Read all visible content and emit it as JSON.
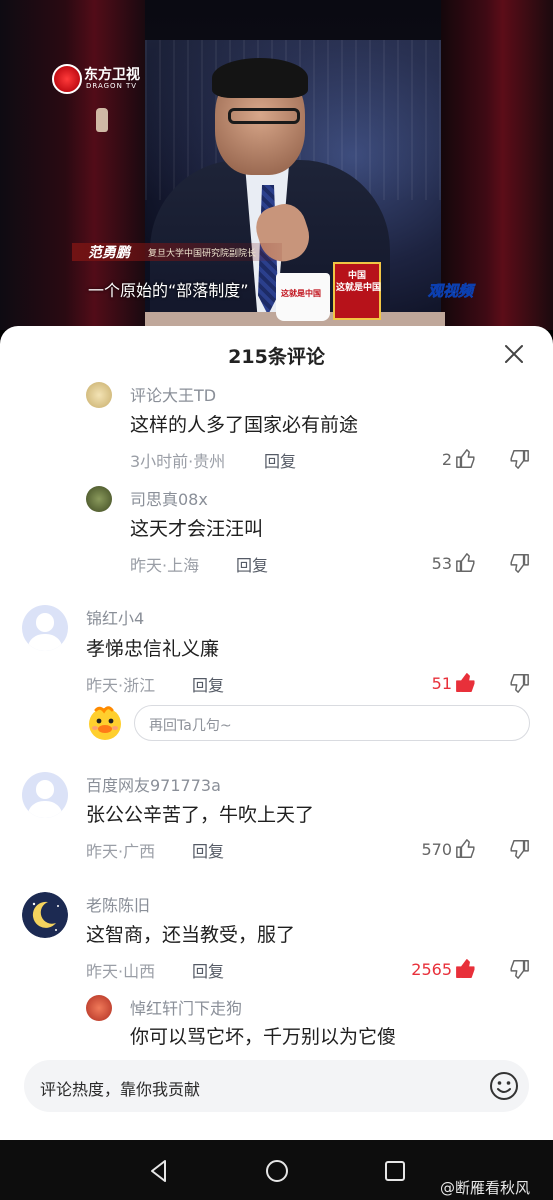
{
  "video": {
    "channel_logo": "东方卫视",
    "channel_sub": "DRAGON TV",
    "speaker_name": "范勇鹏",
    "speaker_title": "复旦大学中国研究院副院长",
    "subtitle": "一个原始的“部落制度”",
    "show_watermark": "观视频",
    "mug_label": "这就是中国",
    "placard_text": "中国\n这就是中国"
  },
  "sheet": {
    "title": "215条评论",
    "close_icon": "close-icon"
  },
  "comments": [
    {
      "user": "评论大王TD",
      "text": "这样的人多了国家必有前途",
      "meta": "3小时前·贵州",
      "reply": "回复",
      "likes": "2",
      "hot": false
    },
    {
      "user": "司思真08x",
      "text": "这天才会汪汪叫",
      "meta": "昨天·上海",
      "reply": "回复",
      "likes": "53",
      "hot": false
    },
    {
      "user": "锦红小4",
      "text": "孝悌忠信礼义廉",
      "meta": "昨天·浙江",
      "reply": "回复",
      "likes": "51",
      "hot": true
    },
    {
      "user": "百度网友971773a",
      "text": "张公公辛苦了，牛吹上天了",
      "meta": "昨天·广西",
      "reply": "回复",
      "likes": "570",
      "hot": false
    },
    {
      "user": "老陈陈旧",
      "text": "这智商，还当教受，服了",
      "meta": "昨天·山西",
      "reply": "回复",
      "likes": "2565",
      "hot": true
    },
    {
      "user": "悼红轩门下走狗",
      "text": "你可以骂它坏，千万别以为它傻"
    }
  ],
  "reply_box": {
    "placeholder": "再回Ta几句~"
  },
  "input_bar": {
    "placeholder": "评论热度，靠你我贡献"
  },
  "watermark": "@断雁看秋风",
  "colors": {
    "hot_like": "#e8303a",
    "accent_red": "#c20d14"
  }
}
